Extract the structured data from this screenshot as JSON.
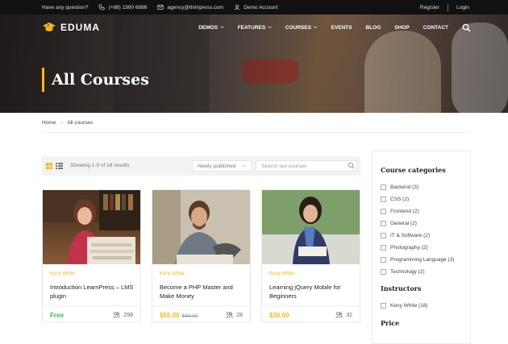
{
  "topbar": {
    "question": "Have any question?",
    "phone": "(+88) 1990 6886",
    "email": "agency@thimpress.com",
    "demo": "Demo Account",
    "register": "Register",
    "login": "Login"
  },
  "nav": {
    "logo": "EDUMA",
    "items": [
      {
        "label": "DEMOS",
        "dropdown": true
      },
      {
        "label": "FEATURES",
        "dropdown": true
      },
      {
        "label": "COURSES",
        "dropdown": true
      },
      {
        "label": "EVENTS",
        "dropdown": false
      },
      {
        "label": "BLOG",
        "dropdown": false
      },
      {
        "label": "SHOP",
        "dropdown": false
      },
      {
        "label": "CONTACT",
        "dropdown": false
      }
    ]
  },
  "hero": {
    "title": "All Courses"
  },
  "breadcrumb": {
    "home": "Home",
    "current": "All courses"
  },
  "toolbar": {
    "showing": "Showing 1-9 of 18 results",
    "sort": "Newly published",
    "search_placeholder": "Search our courses"
  },
  "courses": [
    {
      "author": "Keny White",
      "title": "Introduction LearnPress – LMS plugin",
      "price": "Free",
      "old_price": "",
      "students": "298"
    },
    {
      "author": "Keny White",
      "title": "Become a PHP Master and Make Money",
      "price": "$55.00",
      "old_price": "$69.00",
      "students": "28"
    },
    {
      "author": "Keny White",
      "title": "Learning jQuery Mobile for Beginners",
      "price": "$30.00",
      "old_price": "",
      "students": "32"
    }
  ],
  "sidebar": {
    "categories_title": "Course categories",
    "categories": [
      "Backend (3)",
      "CSS (2)",
      "Frontend (2)",
      "General (2)",
      "IT & Software (2)",
      "Photography (2)",
      "Programming Language (3)",
      "Technology (2)"
    ],
    "instructors_title": "Instructors",
    "instructors": [
      "Keny White (18)"
    ],
    "price_title": "Price"
  },
  "colors": {
    "accent": "#f5b81d",
    "free": "#3fb34f",
    "topbar": "#111111"
  }
}
